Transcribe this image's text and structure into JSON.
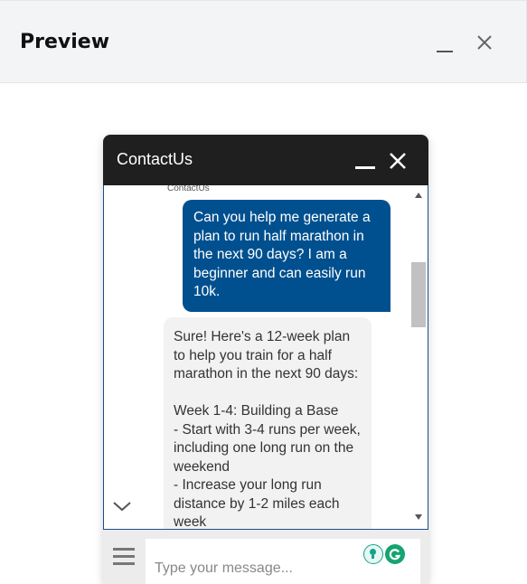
{
  "page": {
    "title": "Preview"
  },
  "widget": {
    "title": "ContactUs",
    "sender_label": "ContactUs",
    "messages": [
      {
        "role": "user",
        "text": "Can you help me generate a plan to run half marathon in the next 90 days? I am a beginner and can easily run 10k."
      },
      {
        "role": "bot",
        "text": "Sure! Here's a 12-week plan to help you train for a half marathon in the next 90 days:\n\nWeek 1-4: Building a Base\n- Start with 3-4 runs per week, including one long run on the weekend\n- Increase your long run distance by 1-2 miles each week"
      }
    ],
    "input_placeholder": "Type your message..."
  },
  "colors": {
    "header_bg": "#1f1f1f",
    "user_bubble": "#00508f",
    "bot_bubble": "#f2f2f2",
    "accent": "#15a472"
  },
  "icons": {
    "page_minimize": "minimize-icon",
    "page_close": "close-icon",
    "widget_minimize": "minimize-icon",
    "widget_close": "close-icon",
    "scroll_down": "chevron-down-icon",
    "menu": "menu-icon",
    "ext_1": "lightbulb-icon",
    "ext_2": "grammarly-icon"
  }
}
